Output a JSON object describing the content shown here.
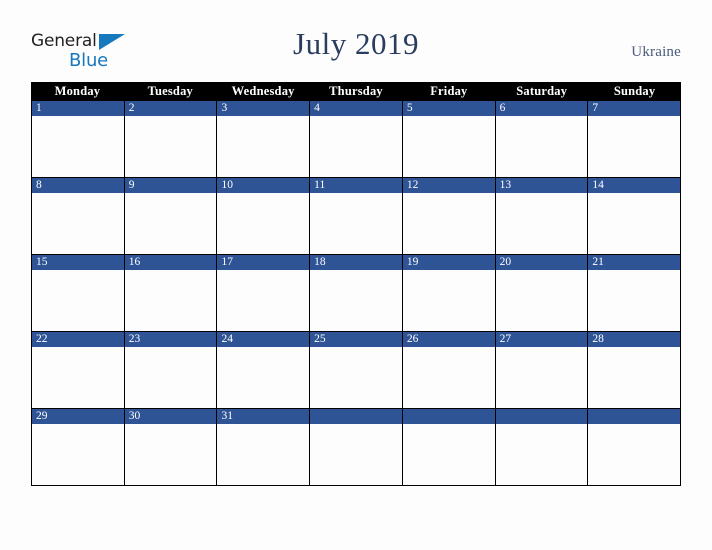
{
  "brand": {
    "name_part1": "General",
    "name_part2": "Blue",
    "triangle_icon": "triangle-icon",
    "accent_color": "#1878be",
    "text_color": "#231f20"
  },
  "header": {
    "title": "July 2019",
    "country": "Ukraine",
    "title_color": "#2b3d5e",
    "country_color": "#4a5a7a"
  },
  "calendar": {
    "month": "July",
    "year": "2019",
    "week_start": "Monday",
    "weekdays": [
      "Monday",
      "Tuesday",
      "Wednesday",
      "Thursday",
      "Friday",
      "Saturday",
      "Sunday"
    ],
    "header_bg": "#000000",
    "header_text": "#ffffff",
    "day_banner_bg": "#2e5496",
    "day_banner_text": "#ffffff",
    "cell_bg": "#fdfdfd",
    "border_color": "#000000",
    "weeks": [
      {
        "days": [
          "1",
          "2",
          "3",
          "4",
          "5",
          "6",
          "7"
        ]
      },
      {
        "days": [
          "8",
          "9",
          "10",
          "11",
          "12",
          "13",
          "14"
        ]
      },
      {
        "days": [
          "15",
          "16",
          "17",
          "18",
          "19",
          "20",
          "21"
        ]
      },
      {
        "days": [
          "22",
          "23",
          "24",
          "25",
          "26",
          "27",
          "28"
        ]
      },
      {
        "days": [
          "29",
          "30",
          "31",
          "",
          "",
          "",
          ""
        ]
      }
    ]
  }
}
